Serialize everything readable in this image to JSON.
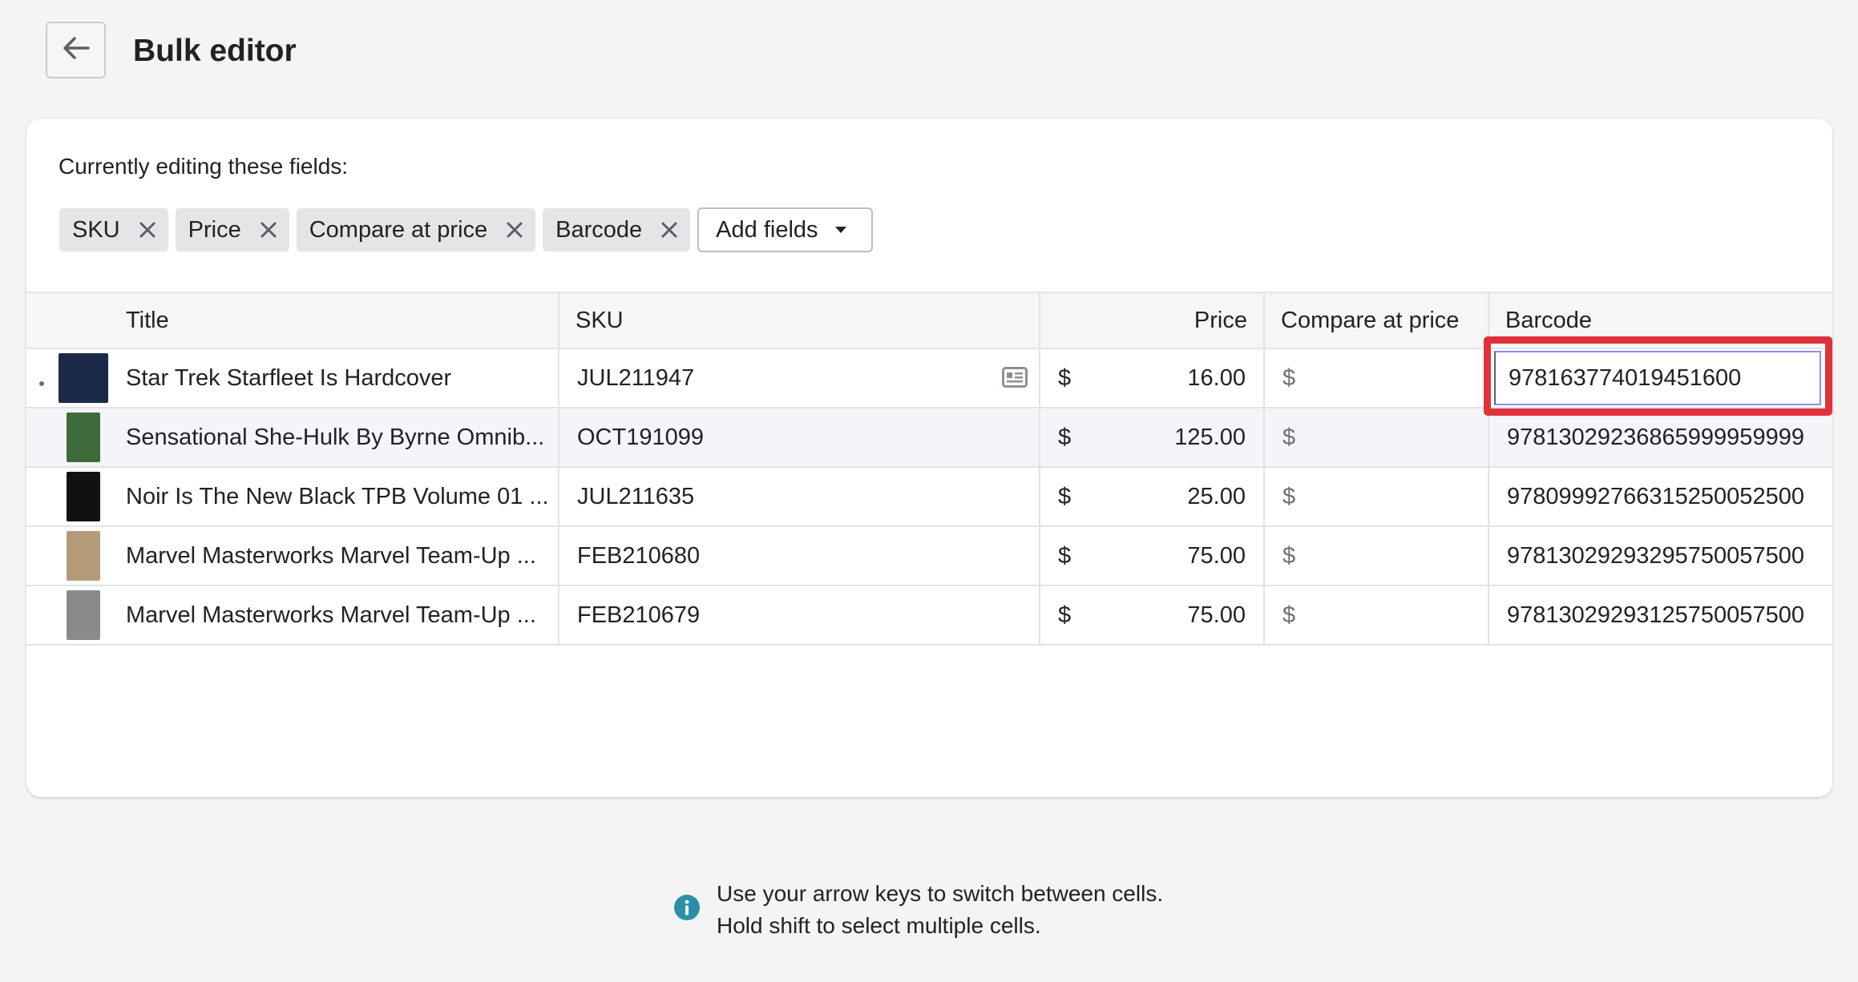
{
  "page": {
    "title": "Bulk editor"
  },
  "editor": {
    "editing_label": "Currently editing these fields:",
    "fields": [
      {
        "label": "SKU"
      },
      {
        "label": "Price"
      },
      {
        "label": "Compare at price"
      },
      {
        "label": "Barcode"
      }
    ],
    "add_fields_label": "Add fields"
  },
  "table": {
    "columns": {
      "title": "Title",
      "sku": "SKU",
      "price": "Price",
      "compare": "Compare at price",
      "barcode": "Barcode"
    },
    "currency_symbol": "$",
    "rows": [
      {
        "title": "Star Trek Starfleet Is Hardcover",
        "sku": "JUL211947",
        "price": "16.00",
        "barcode": "978163774019451600",
        "thumb_color": "#1c2a4a"
      },
      {
        "title": "Sensational She-Hulk By Byrne Omnib...",
        "sku": "OCT191099",
        "price": "125.00",
        "barcode": "97813029236865999959999",
        "thumb_color": "#3f6b3a"
      },
      {
        "title": "Noir Is The New Black TPB Volume 01 ...",
        "sku": "JUL211635",
        "price": "25.00",
        "barcode": "978099927663152500525­00",
        "thumb_color": "#111111"
      },
      {
        "title": "Marvel Masterworks Marvel Team-Up ...",
        "sku": "FEB210680",
        "price": "75.00",
        "barcode": "978130292932957500575­00",
        "thumb_color": "#b59a7a"
      },
      {
        "title": "Marvel Masterworks Marvel Team-Up ...",
        "sku": "FEB210679",
        "price": "75.00",
        "barcode": "978130292931257500575­00",
        "thumb_color": "#8a8a8a"
      }
    ]
  },
  "hint": {
    "line1": "Use your arrow keys to switch between cells.",
    "line2": "Hold shift to select multiple cells."
  },
  "colors": {
    "highlight": "#e0313b",
    "info_icon": "#2c8fa8"
  }
}
